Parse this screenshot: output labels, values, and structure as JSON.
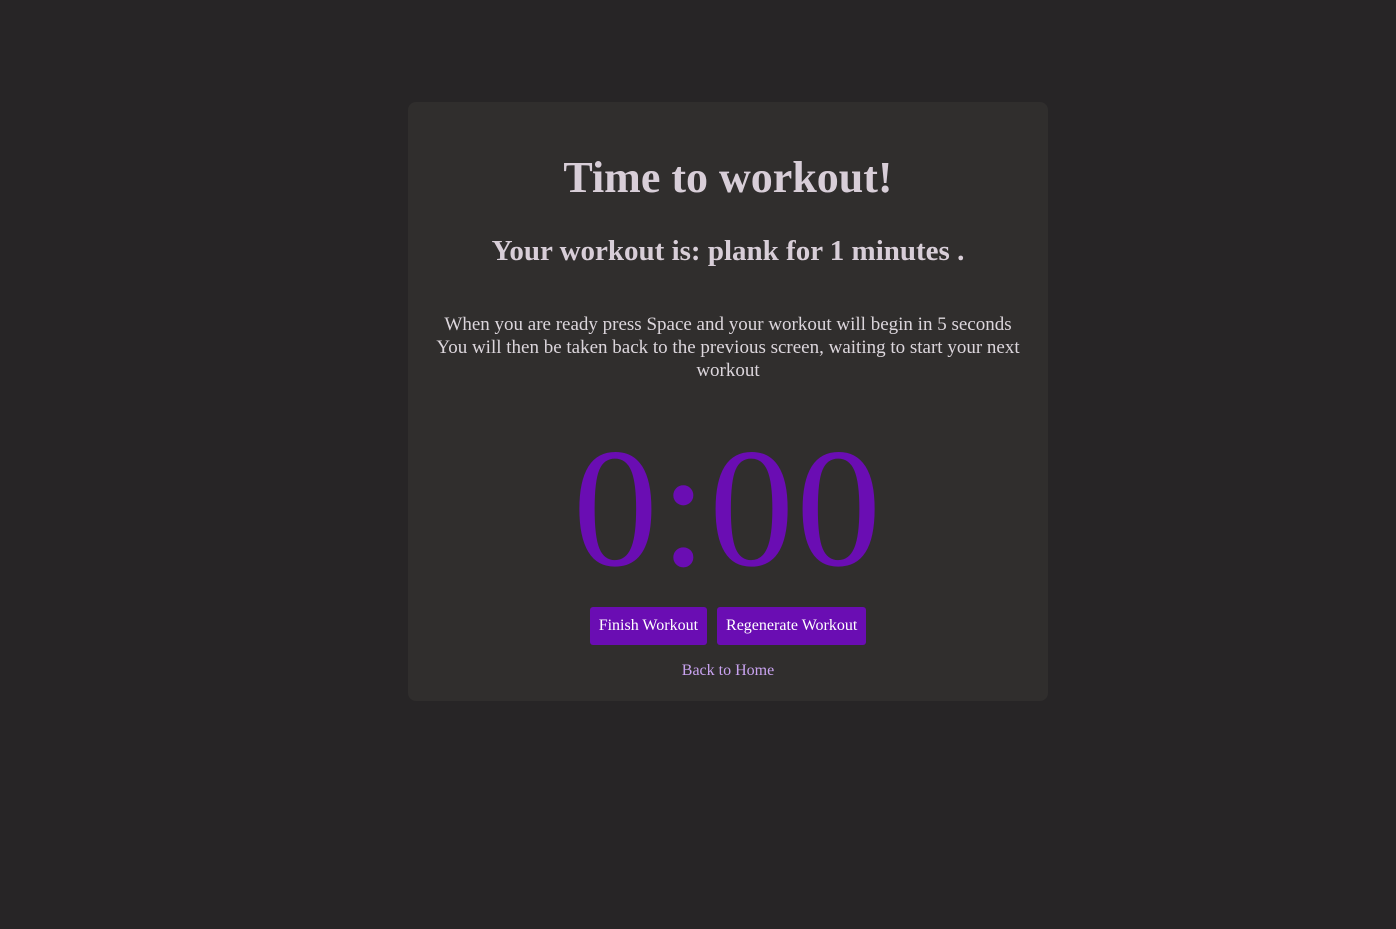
{
  "card": {
    "title": "Time to workout!",
    "subtitle": "Your workout is: plank for 1 minutes .",
    "instructions_line1": "When you are ready press Space and your workout will begin in 5 seconds",
    "instructions_line2": "You will then be taken back to the previous screen, waiting to start your next workout",
    "timer": "0:00",
    "finish_button": "Finish Workout",
    "regenerate_button": "Regenerate Workout",
    "home_link": "Back to Home"
  },
  "colors": {
    "page_background": "#272526",
    "card_background": "#302e2d",
    "accent": "#6a0db3",
    "heading_text": "#d8ced8",
    "link_text": "#c9a3f0"
  }
}
